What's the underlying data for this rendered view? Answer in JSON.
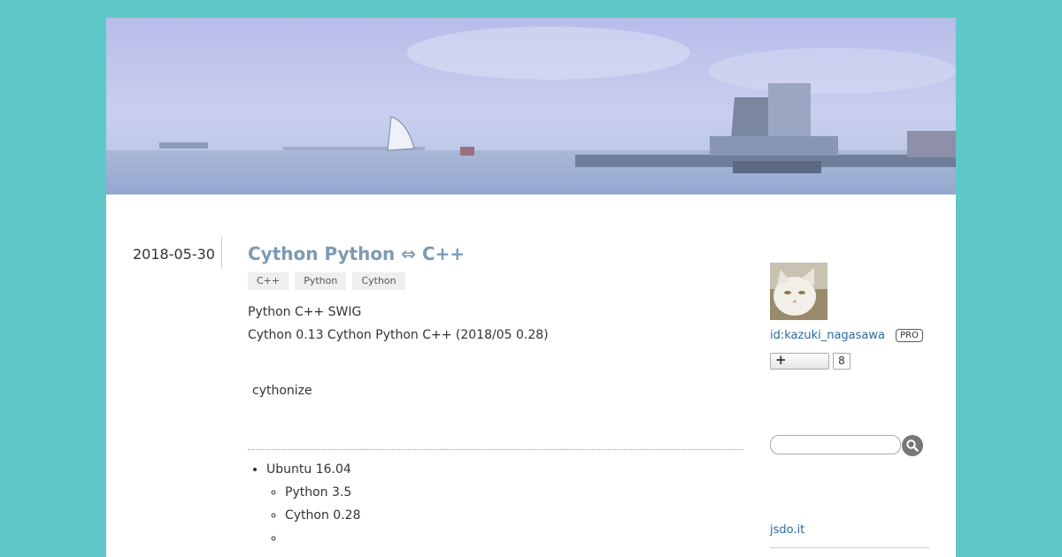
{
  "entry": {
    "date": "2018-05-30",
    "title": "Cython  Python ⇔ C++",
    "tags": [
      "C++",
      "Python",
      "Cython"
    ],
    "paragraphs": [
      "Python  C++  SWIG",
      "Cython 0.13  Cython  Python  C++  (2018/05 0.28)",
      "cythonize"
    ],
    "environment": {
      "os": "Ubuntu 16.04",
      "items": [
        "Python 3.5",
        "Cython 0.28",
        ""
      ]
    }
  },
  "sidebar": {
    "user_id": "id:kazuki_nagasawa",
    "pro_badge": "PRO",
    "subscriber_count": "8",
    "subscribe_icon": "plus-icon",
    "avatar_icon": "cat-photo",
    "search_icon": "magnifier-icon",
    "search_value": "",
    "link": "jsdo.it"
  },
  "colors": {
    "background": "#5fc8c9",
    "title": "#7d9ab0",
    "link": "#2a6aa0",
    "tag_bg": "#efefef"
  }
}
